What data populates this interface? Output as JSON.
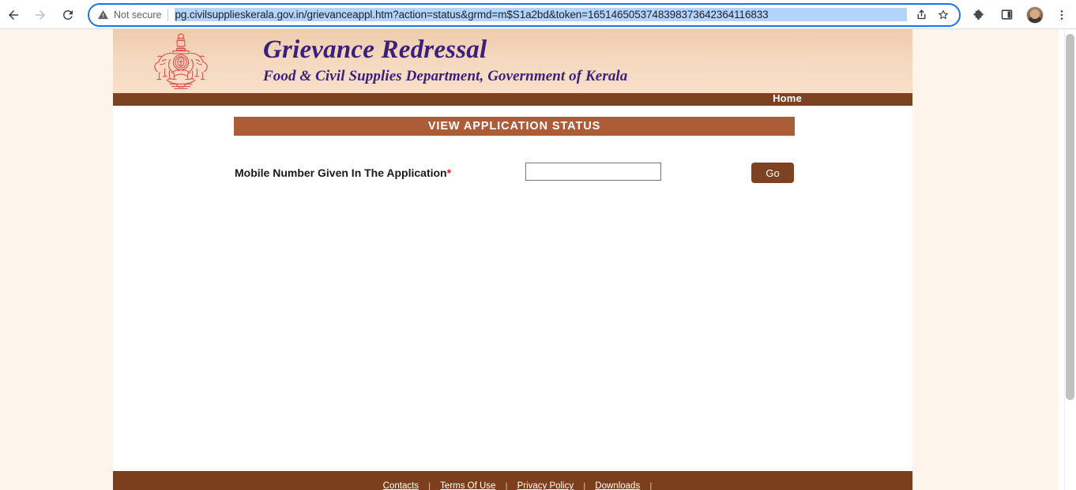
{
  "browser": {
    "back_icon": "back-arrow-icon",
    "forward_icon": "forward-arrow-icon",
    "reload_icon": "reload-icon",
    "security_status": "Not secure",
    "security_icon": "warning-triangle-icon",
    "url": "pg.civilsupplieskerala.gov.in/grievanceappl.htm?action=status&grmd=m$S1a2bd&token=1651465053748398373642364116833",
    "url_selected": true,
    "share_icon": "share-icon",
    "bookmark_icon": "star-icon",
    "extensions_icon": "puzzle-piece-icon",
    "side_panel_icon": "side-panel-icon",
    "profile_icon": "avatar-icon",
    "menu_icon": "three-dot-menu-icon"
  },
  "site": {
    "title": "Grievance Redressal",
    "subtitle": "Food & Civil Supplies Department, Government of Kerala",
    "emblem_icon": "kerala-state-emblem-icon",
    "nav": {
      "home_label": "Home"
    },
    "page_title": "VIEW APPLICATION STATUS",
    "form": {
      "mobile_label": "Mobile Number Given In The Application",
      "required_marker": "*",
      "mobile_value": "",
      "mobile_placeholder": "",
      "submit_label": "Go"
    },
    "footer": {
      "links": [
        "Contacts",
        "Terms Of Use",
        "Privacy Policy",
        "Downloads"
      ],
      "separator": "|"
    }
  },
  "colors": {
    "header_gradient_top": "#efcbab",
    "header_gradient_bottom": "#fadfc9",
    "nav_bar": "#7c4222",
    "title_bar": "#ac5c37",
    "footer_bar": "#7c3f1d",
    "title_text": "#3b1f7a",
    "emblem": "#d9534f",
    "page_background": "#fdf4ec",
    "required": "#e01b1b",
    "omnibox_border": "#1a73e8",
    "url_selection": "#b3d4fd"
  }
}
